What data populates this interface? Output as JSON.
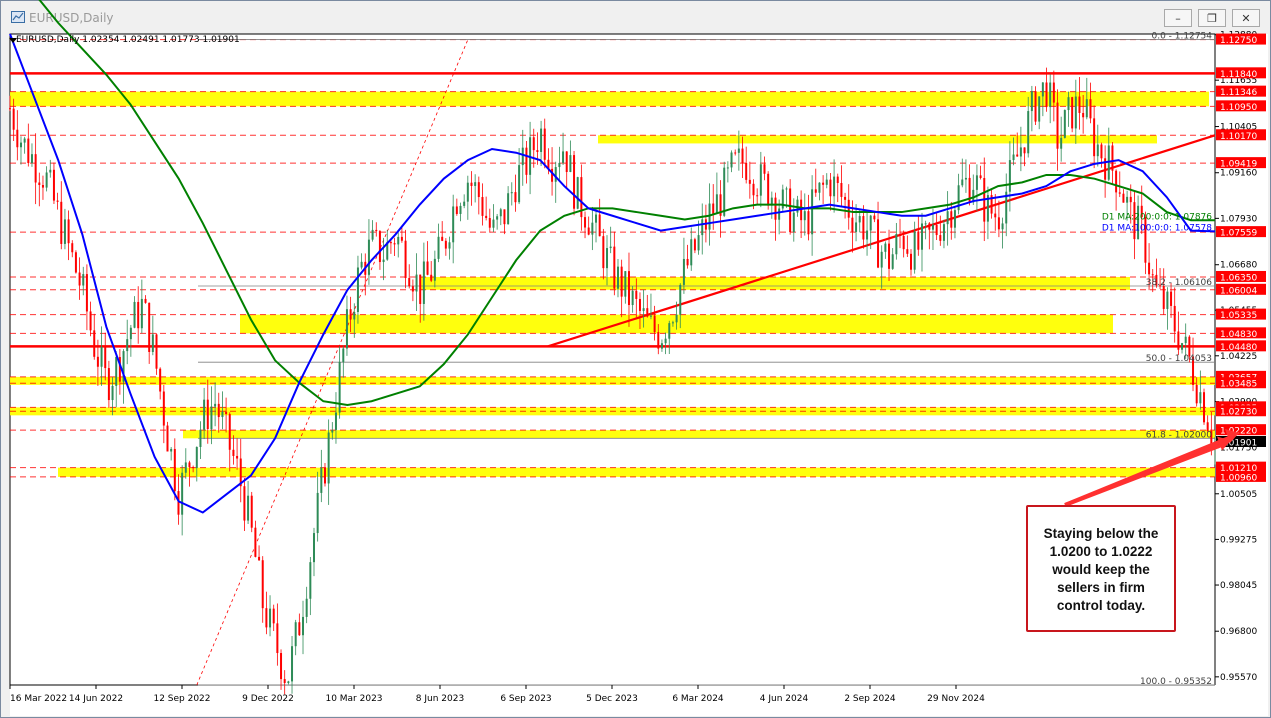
{
  "window": {
    "title": "EURUSD,Daily",
    "buttons": [
      "–",
      "❐",
      "✕"
    ]
  },
  "chart_header": "EURUSD,Daily  1.02354 1.02491 1.01773 1.01901",
  "annotation": {
    "lines": [
      "Staying below the",
      "1.0200 to 1.0222",
      "would keep the",
      "sellers in firm",
      "control today."
    ]
  },
  "colors": {
    "accent_red": "#ff0000",
    "zone_yellow": "#ffff00",
    "ma100": "#0000ff",
    "ma200": "#008000",
    "bull_candle": "#2e8b57",
    "bear_candle": "#ff0000"
  },
  "chart_data": {
    "type": "candlestick",
    "title": "EURUSD,Daily",
    "ohlc_last": {
      "open": 1.02354,
      "high": 1.02491,
      "low": 1.01773,
      "close": 1.01901
    },
    "ylim": [
      0.9535,
      1.129
    ],
    "x_ticks": [
      "16 Mar 2022",
      "14 Jun 2022",
      "12 Sep 2022",
      "9 Dec 2022",
      "10 Mar 2023",
      "8 Jun 2023",
      "6 Sep 2023",
      "5 Dec 2023",
      "6 Mar 2024",
      "4 Jun 2024",
      "2 Sep 2024",
      "29 Nov 2024"
    ],
    "y_ticks": [
      "1.12880",
      "1.11655",
      "1.10405",
      "1.09160",
      "1.07930",
      "1.06680",
      "1.05455",
      "1.04225",
      "1.02990",
      "1.01750",
      "1.00505",
      "0.99275",
      "0.98045",
      "0.96800",
      "0.95570"
    ],
    "price_labels": [
      {
        "text": "1.12750",
        "value": 1.1275,
        "bg": "#ff0000"
      },
      {
        "text": "1.11840",
        "value": 1.1184,
        "bg": "#ff0000"
      },
      {
        "text": "1.11346",
        "value": 1.11346,
        "bg": "#ff0000"
      },
      {
        "text": "1.10950",
        "value": 1.1095,
        "bg": "#ff0000"
      },
      {
        "text": "1.10170",
        "value": 1.1017,
        "bg": "#ff0000"
      },
      {
        "text": "1.09419",
        "value": 1.09419,
        "bg": "#ff0000"
      },
      {
        "text": "1.07559",
        "value": 1.07559,
        "bg": "#ff0000"
      },
      {
        "text": "1.06350",
        "value": 1.0635,
        "bg": "#ff0000"
      },
      {
        "text": "1.06004",
        "value": 1.06004,
        "bg": "#ff0000"
      },
      {
        "text": "1.05335",
        "value": 1.05335,
        "bg": "#ff0000"
      },
      {
        "text": "1.04830",
        "value": 1.0483,
        "bg": "#ff0000"
      },
      {
        "text": "1.04480",
        "value": 1.0448,
        "bg": "#ff0000"
      },
      {
        "text": "1.03657",
        "value": 1.03657,
        "bg": "#ff0000"
      },
      {
        "text": "1.03485",
        "value": 1.03485,
        "bg": "#ff0000"
      },
      {
        "text": "1.02835",
        "value": 1.02835,
        "bg": "#ff0000"
      },
      {
        "text": "1.02730",
        "value": 1.0273,
        "bg": "#ff0000"
      },
      {
        "text": "1.02220",
        "value": 1.0222,
        "bg": "#ff0000"
      },
      {
        "text": "1.01901",
        "value": 1.01901,
        "bg": "#000000"
      },
      {
        "text": "1.01210",
        "value": 1.0121,
        "bg": "#ff0000"
      },
      {
        "text": "1.00960",
        "value": 1.0096,
        "bg": "#ff0000"
      }
    ],
    "fib_labels": [
      {
        "text": "0.0 - 1.12754",
        "value": 1.12754
      },
      {
        "text": "38.2 - 1.06106",
        "value": 1.06106
      },
      {
        "text": "50.0 - 1.04053",
        "value": 1.04053
      },
      {
        "text": "61.8 - 1.02000",
        "value": 1.02
      },
      {
        "text": "100.0 - 0.95352",
        "value": 0.95352
      }
    ],
    "ma_labels": [
      {
        "text": "D1 MA:200:0:0: 1.07876",
        "value": 1.07876,
        "color": "#008000"
      },
      {
        "text": "D1 MA:100:0:0: 1.07578",
        "value": 1.07578,
        "color": "#0000ff"
      }
    ],
    "zones": [
      {
        "low": 1.1095,
        "high": 1.11346
      },
      {
        "low": 1.0995,
        "high": 1.1017
      },
      {
        "low": 1.06004,
        "high": 1.0635
      },
      {
        "low": 1.0483,
        "high": 1.05335
      },
      {
        "low": 1.03485,
        "high": 1.03657
      },
      {
        "low": 1.0273,
        "high": 1.02835
      },
      {
        "low": 1.02,
        "high": 1.0222
      },
      {
        "low": 1.0096,
        "high": 1.0121
      }
    ],
    "horizontal_lines": [
      1.1184,
      1.0448
    ],
    "trendline": {
      "from": [
        "6 Sep 2023",
        1.0448
      ],
      "to": [
        "end",
        1.1017
      ]
    },
    "ma100": [
      [
        0,
        1.129
      ],
      [
        20,
        1.112
      ],
      [
        40,
        1.095
      ],
      [
        60,
        1.075
      ],
      [
        80,
        1.05
      ],
      [
        100,
        1.032
      ],
      [
        120,
        1.015
      ],
      [
        140,
        1.003
      ],
      [
        160,
        1.0
      ],
      [
        180,
        1.005
      ],
      [
        200,
        1.01
      ],
      [
        220,
        1.02
      ],
      [
        240,
        1.035
      ],
      [
        260,
        1.048
      ],
      [
        280,
        1.06
      ],
      [
        300,
        1.068
      ],
      [
        320,
        1.075
      ],
      [
        340,
        1.083
      ],
      [
        360,
        1.09
      ],
      [
        380,
        1.095
      ],
      [
        400,
        1.098
      ],
      [
        420,
        1.097
      ],
      [
        440,
        1.095
      ],
      [
        460,
        1.088
      ],
      [
        480,
        1.082
      ],
      [
        500,
        1.08
      ],
      [
        520,
        1.078
      ],
      [
        540,
        1.076
      ],
      [
        560,
        1.077
      ],
      [
        580,
        1.078
      ],
      [
        600,
        1.079
      ],
      [
        620,
        1.08
      ],
      [
        640,
        1.081
      ],
      [
        660,
        1.082
      ],
      [
        680,
        1.083
      ],
      [
        700,
        1.082
      ],
      [
        720,
        1.081
      ],
      [
        740,
        1.08
      ],
      [
        760,
        1.08
      ],
      [
        780,
        1.082
      ],
      [
        800,
        1.084
      ],
      [
        820,
        1.085
      ],
      [
        840,
        1.086
      ],
      [
        860,
        1.088
      ],
      [
        880,
        1.092
      ],
      [
        900,
        1.094
      ],
      [
        920,
        1.095
      ],
      [
        940,
        1.092
      ],
      [
        960,
        1.085
      ],
      [
        980,
        1.076
      ],
      [
        1000,
        1.0758
      ]
    ],
    "ma200": [
      [
        0,
        1.145
      ],
      [
        20,
        1.14
      ],
      [
        40,
        1.132
      ],
      [
        60,
        1.125
      ],
      [
        80,
        1.118
      ],
      [
        100,
        1.11
      ],
      [
        120,
        1.1
      ],
      [
        140,
        1.09
      ],
      [
        160,
        1.078
      ],
      [
        180,
        1.065
      ],
      [
        200,
        1.052
      ],
      [
        220,
        1.041
      ],
      [
        240,
        1.035
      ],
      [
        260,
        1.03
      ],
      [
        280,
        1.029
      ],
      [
        300,
        1.03
      ],
      [
        320,
        1.032
      ],
      [
        340,
        1.034
      ],
      [
        360,
        1.04
      ],
      [
        380,
        1.048
      ],
      [
        400,
        1.058
      ],
      [
        420,
        1.068
      ],
      [
        440,
        1.076
      ],
      [
        460,
        1.08
      ],
      [
        480,
        1.082
      ],
      [
        500,
        1.082
      ],
      [
        520,
        1.081
      ],
      [
        540,
        1.08
      ],
      [
        560,
        1.079
      ],
      [
        580,
        1.08
      ],
      [
        600,
        1.082
      ],
      [
        620,
        1.083
      ],
      [
        640,
        1.083
      ],
      [
        660,
        1.082
      ],
      [
        680,
        1.082
      ],
      [
        700,
        1.081
      ],
      [
        720,
        1.081
      ],
      [
        740,
        1.081
      ],
      [
        760,
        1.082
      ],
      [
        780,
        1.083
      ],
      [
        800,
        1.085
      ],
      [
        820,
        1.088
      ],
      [
        840,
        1.089
      ],
      [
        860,
        1.091
      ],
      [
        880,
        1.091
      ],
      [
        900,
        1.09
      ],
      [
        920,
        1.088
      ],
      [
        940,
        1.086
      ],
      [
        960,
        1.081
      ],
      [
        980,
        1.0788
      ],
      [
        1000,
        1.0788
      ]
    ],
    "price_path": [
      [
        0,
        1.109
      ],
      [
        10,
        1.1
      ],
      [
        20,
        1.095
      ],
      [
        30,
        1.09
      ],
      [
        40,
        1.08
      ],
      [
        50,
        1.07
      ],
      [
        60,
        1.06
      ],
      [
        70,
        1.045
      ],
      [
        80,
        1.035
      ],
      [
        90,
        1.04
      ],
      [
        100,
        1.05
      ],
      [
        110,
        1.056
      ],
      [
        120,
        1.042
      ],
      [
        130,
        1.022
      ],
      [
        140,
        1.005
      ],
      [
        150,
        1.015
      ],
      [
        160,
        1.025
      ],
      [
        170,
        1.03
      ],
      [
        180,
        1.02
      ],
      [
        190,
        1.01
      ],
      [
        200,
        0.995
      ],
      [
        210,
        0.975
      ],
      [
        220,
        0.965
      ],
      [
        230,
        0.955
      ],
      [
        240,
        0.97
      ],
      [
        250,
        0.99
      ],
      [
        260,
        1.01
      ],
      [
        270,
        1.03
      ],
      [
        280,
        1.05
      ],
      [
        290,
        1.065
      ],
      [
        300,
        1.072
      ],
      [
        310,
        1.07
      ],
      [
        320,
        1.075
      ],
      [
        330,
        1.068
      ],
      [
        340,
        1.06
      ],
      [
        350,
        1.065
      ],
      [
        360,
        1.072
      ],
      [
        370,
        1.085
      ],
      [
        380,
        1.09
      ],
      [
        390,
        1.085
      ],
      [
        400,
        1.075
      ],
      [
        410,
        1.08
      ],
      [
        420,
        1.09
      ],
      [
        430,
        1.095
      ],
      [
        440,
        1.103
      ],
      [
        450,
        1.095
      ],
      [
        460,
        1.099
      ],
      [
        470,
        1.085
      ],
      [
        480,
        1.08
      ],
      [
        490,
        1.072
      ],
      [
        500,
        1.065
      ],
      [
        510,
        1.06
      ],
      [
        520,
        1.055
      ],
      [
        530,
        1.05
      ],
      [
        540,
        1.048
      ],
      [
        550,
        1.055
      ],
      [
        560,
        1.065
      ],
      [
        570,
        1.072
      ],
      [
        580,
        1.08
      ],
      [
        590,
        1.085
      ],
      [
        600,
        1.093
      ],
      [
        610,
        1.095
      ],
      [
        620,
        1.09
      ],
      [
        630,
        1.087
      ],
      [
        640,
        1.083
      ],
      [
        650,
        1.08
      ],
      [
        660,
        1.078
      ],
      [
        670,
        1.085
      ],
      [
        680,
        1.09
      ],
      [
        690,
        1.085
      ],
      [
        700,
        1.08
      ],
      [
        710,
        1.077
      ],
      [
        720,
        1.072
      ],
      [
        730,
        1.068
      ],
      [
        740,
        1.075
      ],
      [
        750,
        1.07
      ],
      [
        760,
        1.073
      ],
      [
        770,
        1.077
      ],
      [
        780,
        1.082
      ],
      [
        790,
        1.088
      ],
      [
        800,
        1.09
      ],
      [
        810,
        1.082
      ],
      [
        820,
        1.08
      ],
      [
        830,
        1.09
      ],
      [
        840,
        1.1
      ],
      [
        850,
        1.11
      ],
      [
        860,
        1.115
      ],
      [
        870,
        1.1
      ],
      [
        880,
        1.108
      ],
      [
        890,
        1.11
      ],
      [
        900,
        1.1
      ],
      [
        910,
        1.095
      ],
      [
        920,
        1.09
      ],
      [
        930,
        1.08
      ],
      [
        940,
        1.075
      ],
      [
        950,
        1.06
      ],
      [
        960,
        1.055
      ],
      [
        970,
        1.048
      ],
      [
        980,
        1.04
      ],
      [
        990,
        1.03
      ],
      [
        1000,
        1.019
      ]
    ]
  }
}
